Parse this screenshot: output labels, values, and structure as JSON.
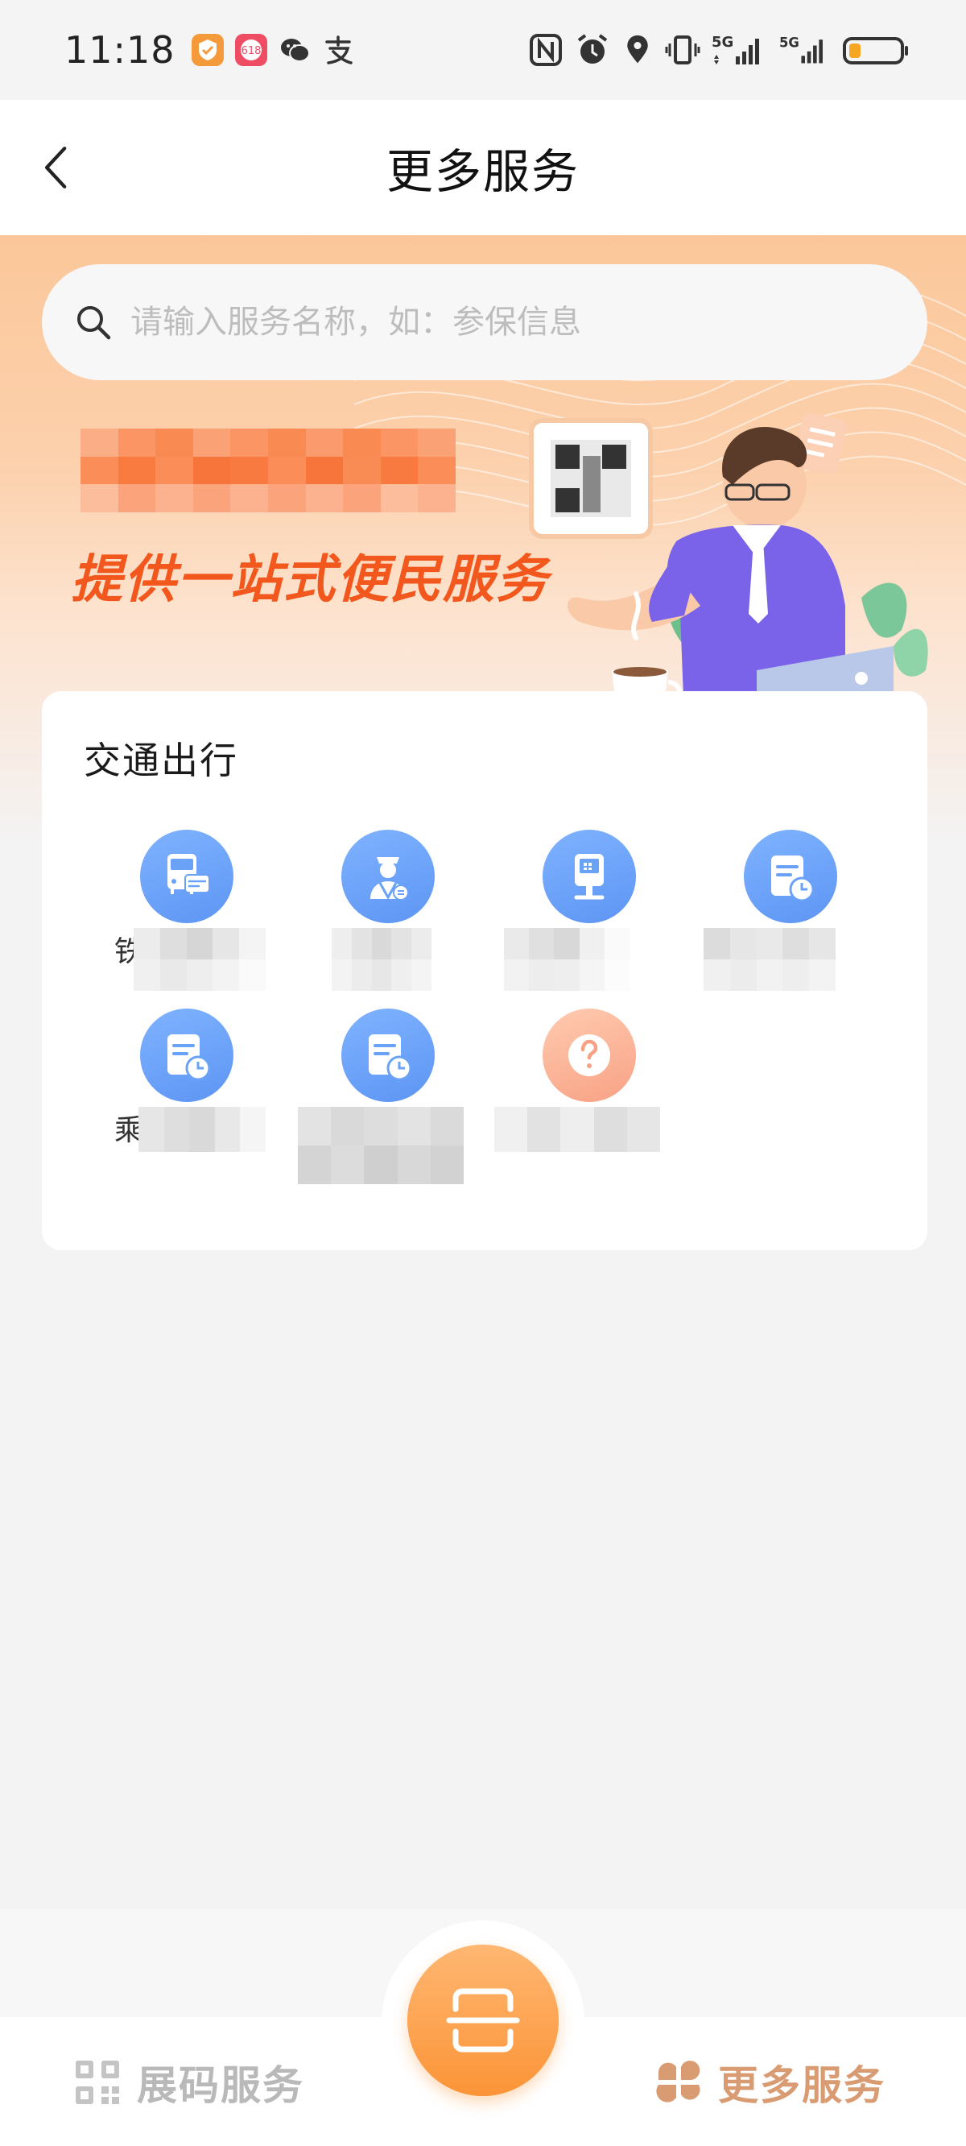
{
  "status_bar": {
    "time": "11:18",
    "app_icons": [
      "checkmark-shield-app-icon",
      "618-promo-app-icon",
      "wechat-icon",
      "alipay-icon"
    ],
    "system_icons": [
      "nfc-icon",
      "alarm-icon",
      "location-icon",
      "vibrate-icon",
      "signal-5g-icon",
      "signal-5g-icon",
      "battery-icon"
    ],
    "network_1": "5G",
    "network_2": "5G"
  },
  "header": {
    "title": "更多服务",
    "back_icon": "chevron-left-icon"
  },
  "search": {
    "placeholder": "请输入服务名称，如：参保信息",
    "value": ""
  },
  "banner": {
    "slogan": "提供一站式便民服务"
  },
  "section": {
    "title": "交通出行",
    "items": [
      {
        "icon": "bus-card-icon",
        "label_visible_char": "铁",
        "color": "blue"
      },
      {
        "icon": "driver-icon",
        "label_visible_char": "",
        "color": "blue"
      },
      {
        "icon": "kiosk-icon",
        "label_visible_char": "",
        "color": "blue"
      },
      {
        "icon": "schedule-doc-icon",
        "label_visible_char": "",
        "color": "blue"
      },
      {
        "icon": "schedule-doc-icon",
        "label_visible_char": "乘",
        "color": "blue"
      },
      {
        "icon": "schedule-doc-icon",
        "label_visible_char": "",
        "color": "blue"
      },
      {
        "icon": "question-icon",
        "label_visible_char": "",
        "color": "orange"
      }
    ]
  },
  "bottom_nav": {
    "left_label": "展码服务",
    "left_icon": "qr-code-icon",
    "center_icon": "scan-icon",
    "right_label": "更多服务",
    "right_icon": "grid-clover-icon"
  },
  "colors": {
    "accent_orange": "#fb9437",
    "slogan": "#f2581e",
    "icon_blue": "#6aa2f8",
    "nav_active": "#d99b72",
    "nav_inactive": "#b9b9b9"
  }
}
